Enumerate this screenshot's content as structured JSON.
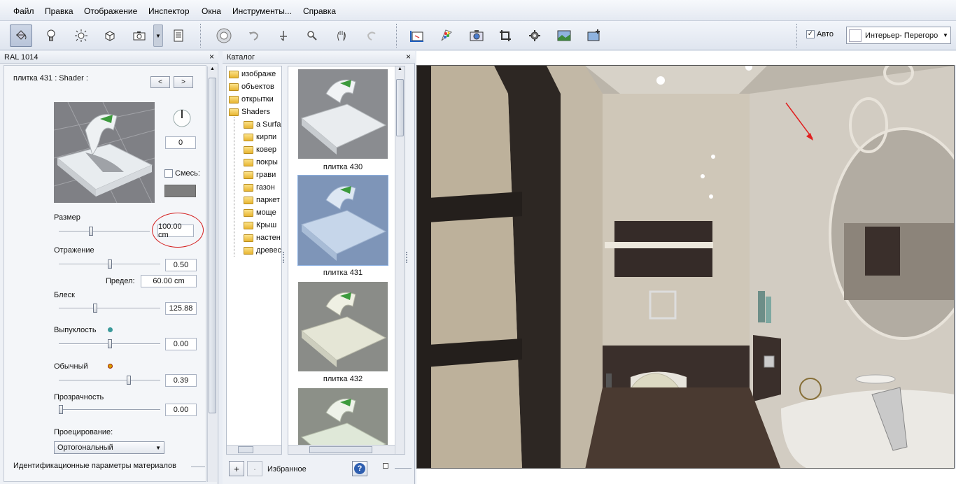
{
  "menu": [
    "Файл",
    "Правка",
    "Отображение",
    "Инспектор",
    "Окна",
    "Инструменты...",
    "Справка"
  ],
  "toolbar": {
    "left_icons": [
      "paint-bucket-icon",
      "lightbulb-icon",
      "sun-icon",
      "cube-icon",
      "camera-icon",
      "dropdown-arrow-icon",
      "list-icon"
    ],
    "nav_icons": [
      "orbit-icon",
      "undo-rotate-icon",
      "walk-icon",
      "zoom-icon",
      "pan-hand-icon",
      "redo-rotate-icon"
    ],
    "render_icons": [
      "axis-view-icon",
      "palette-icon",
      "render-camera-icon",
      "crop-icon",
      "settings-gear-icon",
      "image-view-icon",
      "add-image-icon"
    ],
    "auto_label": "Авто",
    "auto_checked": true,
    "view_combo": "Интерьер- Перегоро"
  },
  "inspector": {
    "title": "RAL 1014",
    "material_name": "плитка 431 : Shader :",
    "prev_label": "<",
    "next_label": ">",
    "rotation_value": "0",
    "mix_label": "Смесь:",
    "size_label": "Размер",
    "size_value": "100.00 cm",
    "size_fraction": 0.35,
    "reflection_label": "Отражение",
    "reflection_value": "0.50",
    "reflection_fraction": 0.5,
    "limit_label": "Предел:",
    "limit_value": "60.00 cm",
    "gloss_label": "Блеск",
    "gloss_value": "125.88",
    "gloss_fraction": 0.35,
    "bump_label": "Выпуклость",
    "bump_value": "0.00",
    "bump_fraction": 0.5,
    "normal_label": "Обычный",
    "normal_value": "0.39",
    "normal_fraction": 0.7,
    "transparency_label": "Прозрачность",
    "transparency_value": "0.00",
    "transparency_fraction": 0.0,
    "projection_label": "Проецирование:",
    "projection_value": "Ортогональный",
    "id_params_label": "Идентификационные параметры материалов"
  },
  "catalog": {
    "title": "Каталог",
    "tree": [
      "изображе",
      "объектов",
      "открытки",
      "Shaders"
    ],
    "subtree": [
      "a Surfa",
      "кирпи",
      "ковер",
      "покры",
      "грави",
      "газон",
      "паркет",
      "моще",
      "Крыш",
      "настен",
      "древес"
    ],
    "thumbs": [
      "плитка 430",
      "плитка 431",
      "плитка 432"
    ],
    "favorites_label": "Избранное",
    "add_label": "+",
    "minus_label": "·",
    "help_label": "?"
  },
  "colors": {
    "ellipse": "#d42020",
    "arrow": "#e02020",
    "mix_swatch": "#7e7e7e"
  }
}
